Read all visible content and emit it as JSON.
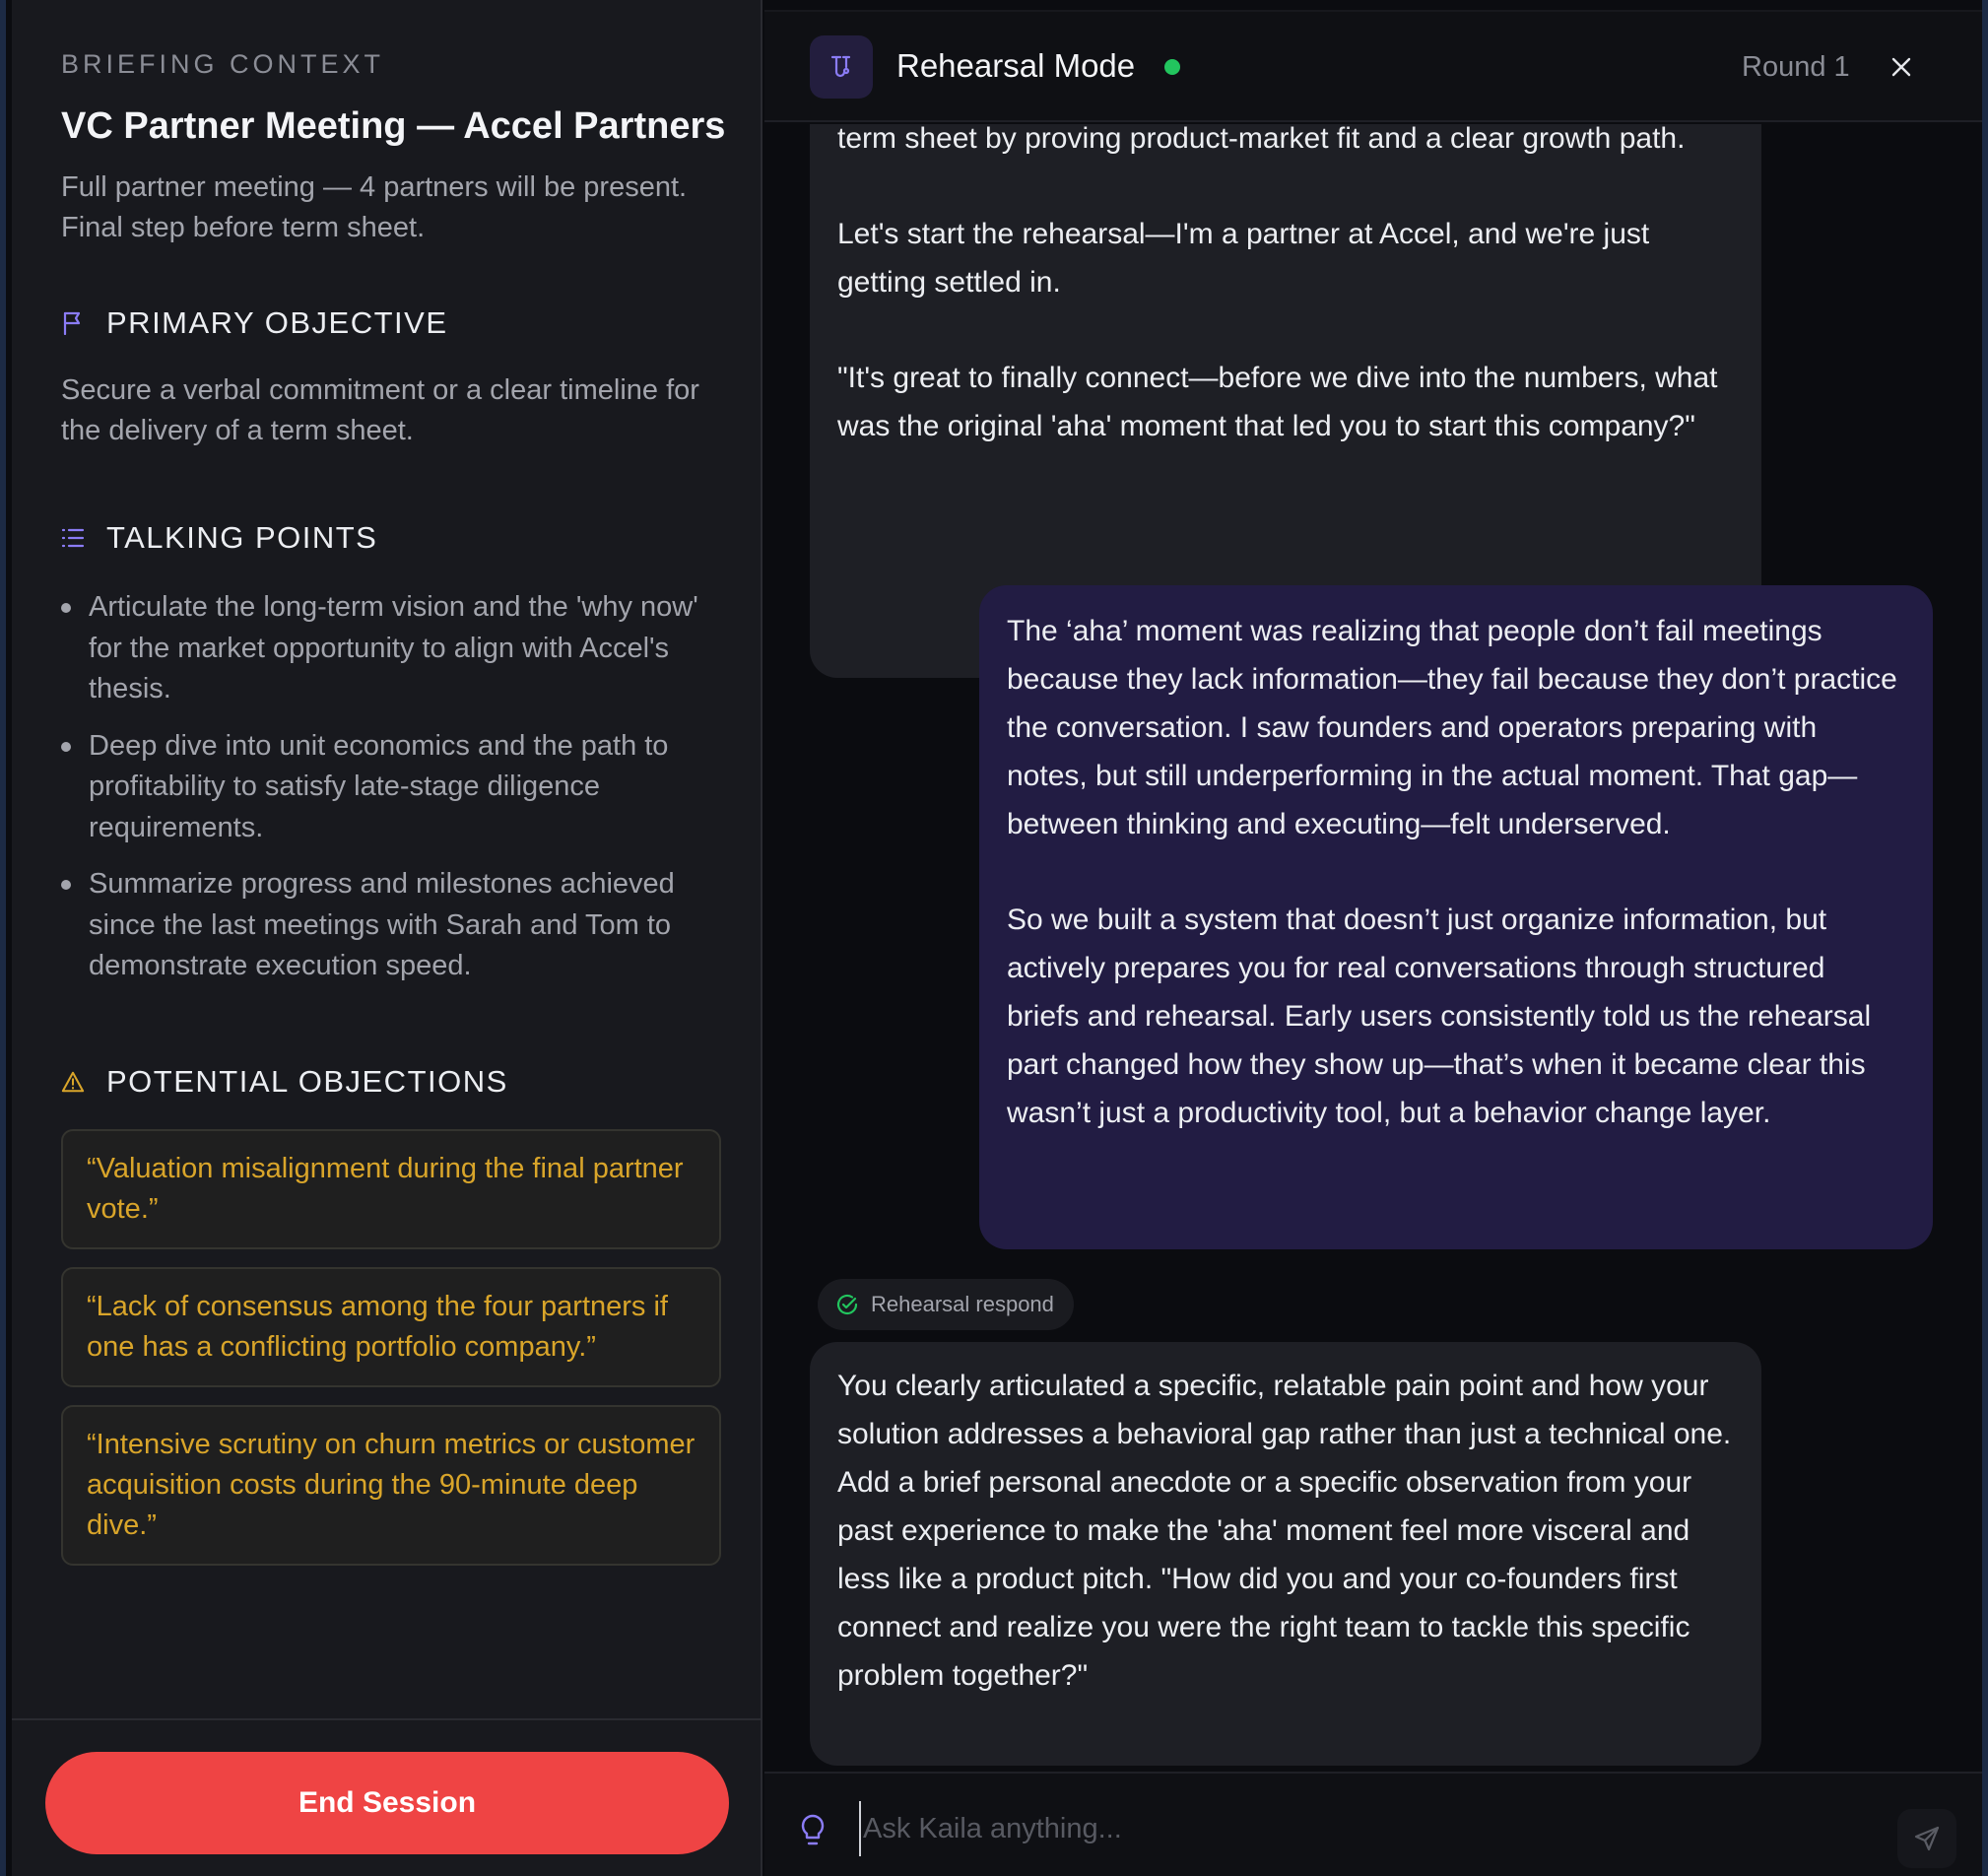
{
  "briefing": {
    "eyebrow": "BRIEFING CONTEXT",
    "title": "VC Partner Meeting — Accel Partners",
    "description": "Full partner meeting — 4 partners will be present. Final step before term sheet."
  },
  "primary_objective": {
    "heading": "PRIMARY OBJECTIVE",
    "text": "Secure a verbal commitment or a clear timeline for the delivery of a term sheet."
  },
  "talking_points": {
    "heading": "TALKING POINTS",
    "items": [
      "Articulate the long-term vision and the 'why now' for the market opportunity to align with Accel's thesis.",
      "Deep dive into unit economics and the path to profitability to satisfy late-stage diligence requirements.",
      "Summarize progress and milestones achieved since the last meetings with Sarah and Tom to demonstrate execution speed."
    ]
  },
  "objections": {
    "heading": "POTENTIAL OBJECTIONS",
    "items": [
      "“Valuation misalignment during the final partner vote.”",
      "“Lack of consensus among the four partners if one has a conflicting portfolio company.”",
      "“Intensive scrutiny on churn metrics or customer acquisition costs during the 90-minute deep dive.”"
    ]
  },
  "end_session_label": "End Session",
  "header": {
    "mode_title": "Rehearsal Mode",
    "round_label": "Round 1",
    "status_color": "#22c55e"
  },
  "messages": {
    "ai_first": {
      "p1": "term sheet by proving product-market fit and a clear growth path.",
      "p2": "Let's start the rehearsal—I'm a partner at Accel, and we're just getting settled in.",
      "p3": "\"It's great to finally connect—before we dive into the numbers, what was the original 'aha' moment that led you to start this company?\""
    },
    "user": {
      "p1": "The ‘aha’ moment was realizing that people don’t fail meetings because they lack information—they fail because they don’t practice the conversation. I saw founders and operators preparing with notes, but still underperforming in the actual moment. That gap—between thinking and executing—felt underserved.",
      "p2": "So we built a system that doesn’t just organize information, but actively prepares you for real conversations through structured briefs and rehearsal. Early users consistently told us the rehearsal part changed how they show up—that’s when it became clear this wasn’t just a productivity tool, but a behavior change layer."
    },
    "chip_label": "Rehearsal respond",
    "ai_feedback": "You clearly articulated a specific, relatable pain point and how your solution addresses a behavioral gap rather than just a technical one. Add a brief personal anecdote or a specific observation from your past experience to make the 'aha' moment feel more visceral and less like a product pitch. \"How did you and your co-founders first connect and realize you were the right team to tackle this specific problem together?\""
  },
  "composer": {
    "placeholder": "Ask Kaila anything..."
  },
  "colors": {
    "accent_purple": "#8b7cf6",
    "objection_text": "#d9a52a",
    "end_button": "#ef4444",
    "user_bubble": "#221c43"
  }
}
